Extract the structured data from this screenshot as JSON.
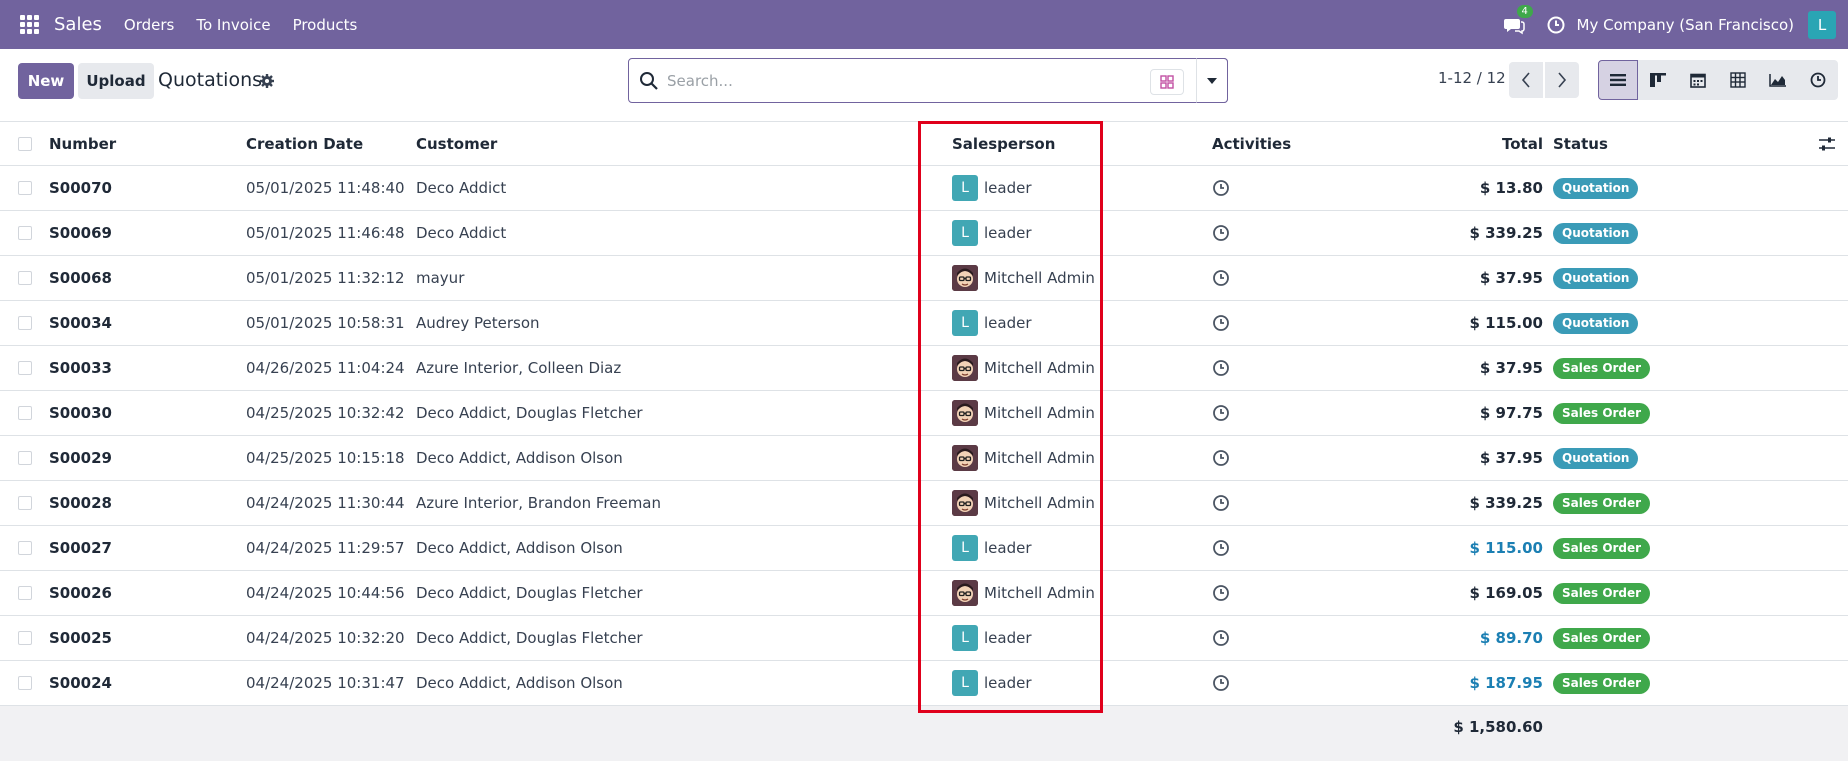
{
  "navbar": {
    "app_name": "Sales",
    "menu": [
      "Orders",
      "To Invoice",
      "Products"
    ],
    "chat_count": "4",
    "company": "My Company (San Francisco)",
    "user_initial": "L"
  },
  "control_panel": {
    "new_label": "New",
    "upload_label": "Upload",
    "title": "Quotations",
    "search_placeholder": "Search...",
    "pager": "1-12 / 12"
  },
  "table": {
    "headers": {
      "number": "Number",
      "date": "Creation Date",
      "customer": "Customer",
      "salesperson": "Salesperson",
      "activities": "Activities",
      "total": "Total",
      "status": "Status"
    },
    "rows": [
      {
        "number": "S00070",
        "date": "05/01/2025 11:48:40",
        "customer": "Deco Addict",
        "sp_initial": "L",
        "salesperson": "leader",
        "sp_type": "initial",
        "total": "$ 13.80",
        "total_color": "dark",
        "status": "Quotation",
        "status_type": "q"
      },
      {
        "number": "S00069",
        "date": "05/01/2025 11:46:48",
        "customer": "Deco Addict",
        "sp_initial": "L",
        "salesperson": "leader",
        "sp_type": "initial",
        "total": "$ 339.25",
        "total_color": "dark",
        "status": "Quotation",
        "status_type": "q"
      },
      {
        "number": "S00068",
        "date": "05/01/2025 11:32:12",
        "customer": "mayur",
        "sp_initial": "",
        "salesperson": "Mitchell Admin",
        "sp_type": "img",
        "total": "$ 37.95",
        "total_color": "dark",
        "status": "Quotation",
        "status_type": "q"
      },
      {
        "number": "S00034",
        "date": "05/01/2025 10:58:31",
        "customer": "Audrey Peterson",
        "sp_initial": "L",
        "salesperson": "leader",
        "sp_type": "initial",
        "total": "$ 115.00",
        "total_color": "dark",
        "status": "Quotation",
        "status_type": "q"
      },
      {
        "number": "S00033",
        "date": "04/26/2025 11:04:24",
        "customer": "Azure Interior, Colleen Diaz",
        "sp_initial": "",
        "salesperson": "Mitchell Admin",
        "sp_type": "img",
        "total": "$ 37.95",
        "total_color": "dark",
        "status": "Sales Order",
        "status_type": "s"
      },
      {
        "number": "S00030",
        "date": "04/25/2025 10:32:42",
        "customer": "Deco Addict, Douglas Fletcher",
        "sp_initial": "",
        "salesperson": "Mitchell Admin",
        "sp_type": "img",
        "total": "$ 97.75",
        "total_color": "dark",
        "status": "Sales Order",
        "status_type": "s"
      },
      {
        "number": "S00029",
        "date": "04/25/2025 10:15:18",
        "customer": "Deco Addict, Addison Olson",
        "sp_initial": "",
        "salesperson": "Mitchell Admin",
        "sp_type": "img",
        "total": "$ 37.95",
        "total_color": "dark",
        "status": "Quotation",
        "status_type": "q"
      },
      {
        "number": "S00028",
        "date": "04/24/2025 11:30:44",
        "customer": "Azure Interior, Brandon Freeman",
        "sp_initial": "",
        "salesperson": "Mitchell Admin",
        "sp_type": "img",
        "total": "$ 339.25",
        "total_color": "dark",
        "status": "Sales Order",
        "status_type": "s"
      },
      {
        "number": "S00027",
        "date": "04/24/2025 11:29:57",
        "customer": "Deco Addict, Addison Olson",
        "sp_initial": "L",
        "salesperson": "leader",
        "sp_type": "initial",
        "total": "$ 115.00",
        "total_color": "blue",
        "status": "Sales Order",
        "status_type": "s"
      },
      {
        "number": "S00026",
        "date": "04/24/2025 10:44:56",
        "customer": "Deco Addict, Douglas Fletcher",
        "sp_initial": "",
        "salesperson": "Mitchell Admin",
        "sp_type": "img",
        "total": "$ 169.05",
        "total_color": "dark",
        "status": "Sales Order",
        "status_type": "s"
      },
      {
        "number": "S00025",
        "date": "04/24/2025 10:32:20",
        "customer": "Deco Addict, Douglas Fletcher",
        "sp_initial": "L",
        "salesperson": "leader",
        "sp_type": "initial",
        "total": "$ 89.70",
        "total_color": "blue",
        "status": "Sales Order",
        "status_type": "s"
      },
      {
        "number": "S00024",
        "date": "04/24/2025 10:31:47",
        "customer": "Deco Addict, Addison Olson",
        "sp_initial": "L",
        "salesperson": "leader",
        "sp_type": "initial",
        "total": "$ 187.95",
        "total_color": "blue",
        "status": "Sales Order",
        "status_type": "s"
      }
    ],
    "grand_total": "$ 1,580.60"
  },
  "colors": {
    "brand": "#71639e",
    "highlight": "#e0001b",
    "quotation_badge": "#3a9bb7",
    "sales_order_badge": "#3fa84b",
    "link_total": "#1b7fb3"
  }
}
